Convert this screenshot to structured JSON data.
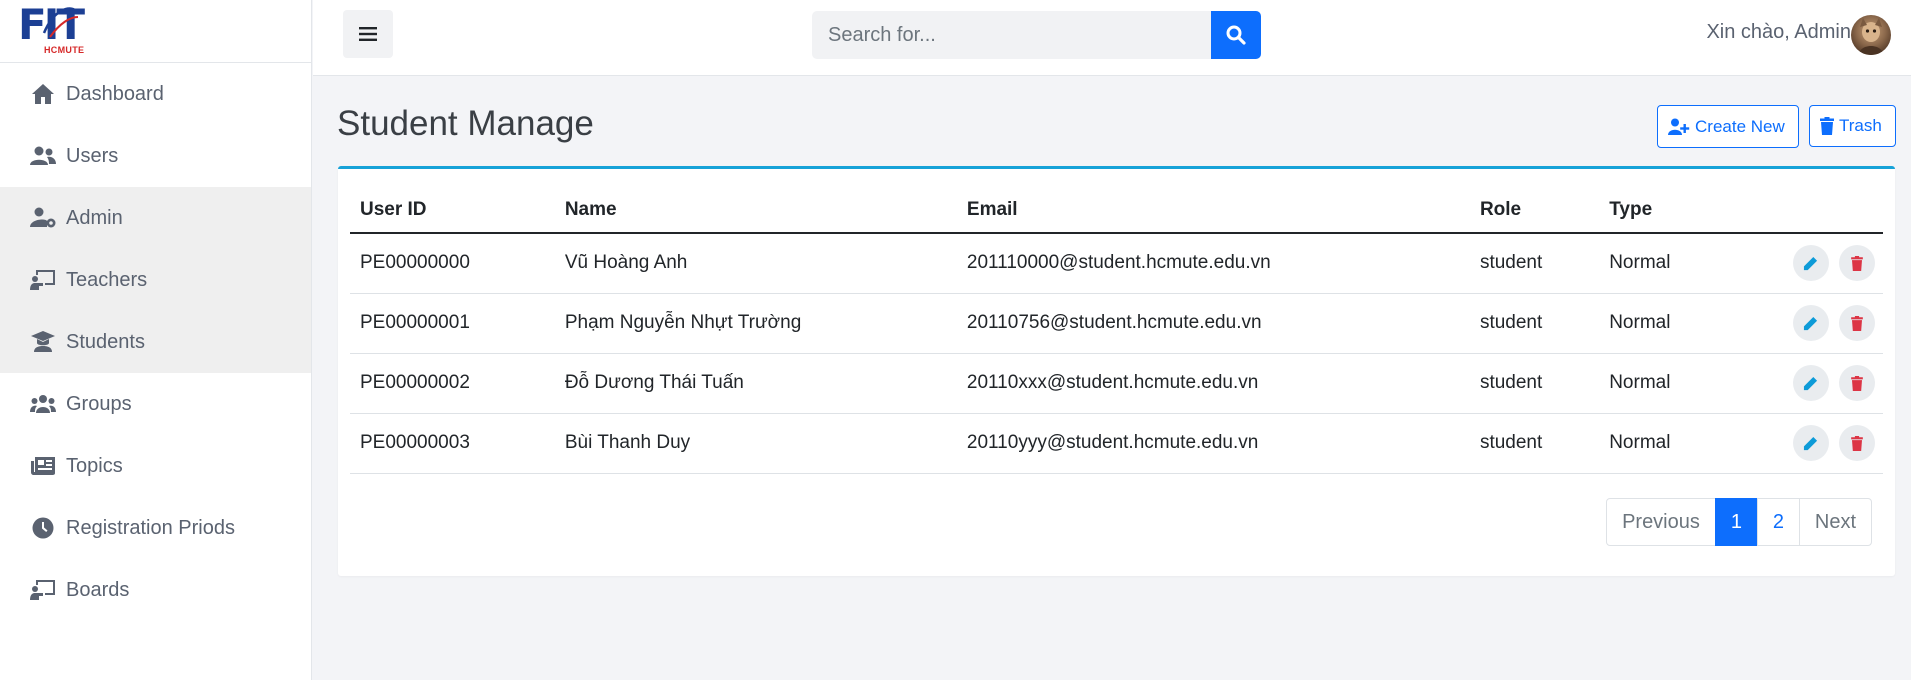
{
  "logo": {
    "main": "FIT",
    "sub": "HCMUTE"
  },
  "sidebar": {
    "items": [
      {
        "label": "Dashboard",
        "icon": "home-icon",
        "active": false
      },
      {
        "label": "Users",
        "icon": "users-icon",
        "active": false
      },
      {
        "label": "Admin",
        "icon": "user-gear-icon",
        "active": true
      },
      {
        "label": "Teachers",
        "icon": "chalkboard-teacher-icon",
        "active": true
      },
      {
        "label": "Students",
        "icon": "graduate-icon",
        "active": true
      },
      {
        "label": "Groups",
        "icon": "group-icon",
        "active": false
      },
      {
        "label": "Topics",
        "icon": "newspaper-icon",
        "active": false
      },
      {
        "label": "Registration Priods",
        "icon": "clock-icon",
        "active": false
      },
      {
        "label": "Boards",
        "icon": "chalkboard-teacher-icon",
        "active": false
      }
    ]
  },
  "topbar": {
    "search_placeholder": "Search for...",
    "search_value": "",
    "greeting": "Xin chào, Admin"
  },
  "main": {
    "title": "Student Manage",
    "create_label": "Create New",
    "trash_label": "Trash",
    "table": {
      "headers": [
        "User ID",
        "Name",
        "Email",
        "Role",
        "Type"
      ],
      "rows": [
        {
          "id": "PE00000000",
          "name": "Vũ Hoàng Anh",
          "email": "201110000@student.hcmute.edu.vn",
          "role": "student",
          "type": "Normal"
        },
        {
          "id": "PE00000001",
          "name": "Phạm Nguyễn Nhựt Trường",
          "email": "20110756@student.hcmute.edu.vn",
          "role": "student",
          "type": "Normal"
        },
        {
          "id": "PE00000002",
          "name": "Đỗ Dương Thái Tuấn",
          "email": "20110xxx@student.hcmute.edu.vn",
          "role": "student",
          "type": "Normal"
        },
        {
          "id": "PE00000003",
          "name": "Bùi Thanh Duy",
          "email": "20110yyy@student.hcmute.edu.vn",
          "role": "student",
          "type": "Normal"
        }
      ]
    },
    "pagination": {
      "previous": "Previous",
      "pages": [
        "1",
        "2"
      ],
      "current": "1",
      "next": "Next"
    }
  },
  "colors": {
    "primary": "#0d6efd",
    "danger": "#dc3545",
    "card_accent": "#17a2d8",
    "logo_blue": "#1c3f94",
    "logo_red": "#d62828"
  }
}
